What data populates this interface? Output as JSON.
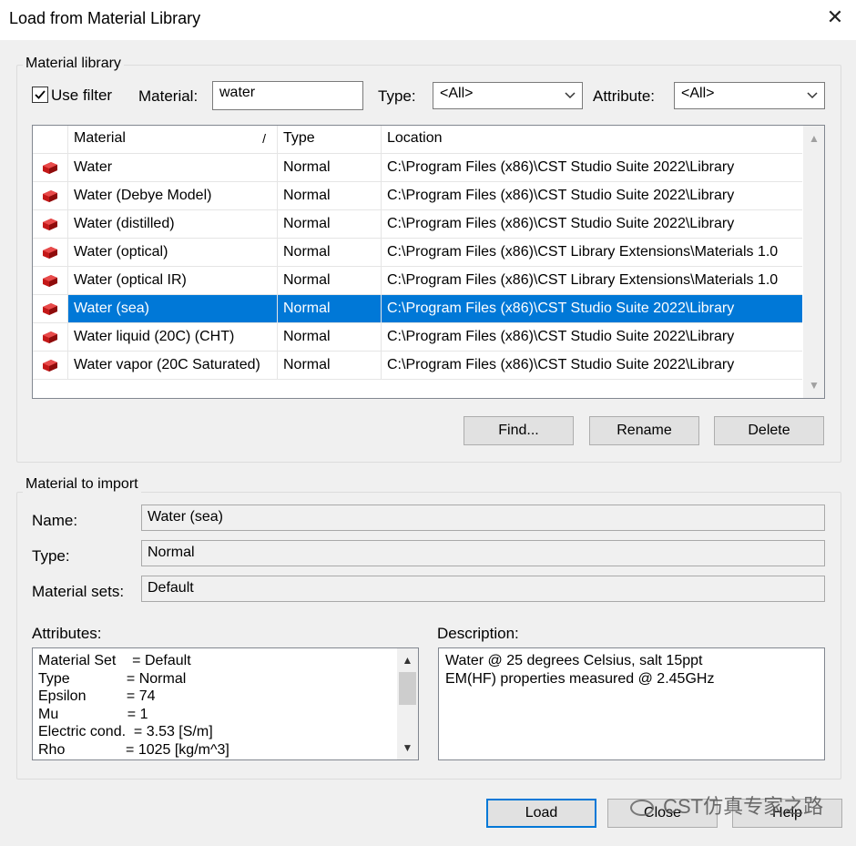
{
  "window": {
    "title": "Load from Material Library",
    "close_glyph": "✕"
  },
  "library": {
    "group_label": "Material library",
    "use_filter_label": "Use filter",
    "use_filter_checked": true,
    "material_label": "Material:",
    "material_value": "water",
    "type_label": "Type:",
    "type_value": "<All>",
    "attribute_label": "Attribute:",
    "attribute_value": "<All>",
    "columns": {
      "material": "Material",
      "sort_glyph": "/",
      "type": "Type",
      "location": "Location"
    },
    "rows": [
      {
        "name": "Water",
        "type": "Normal",
        "location": "C:\\Program Files (x86)\\CST Studio Suite 2022\\Library"
      },
      {
        "name": "Water (Debye Model)",
        "type": "Normal",
        "location": "C:\\Program Files (x86)\\CST Studio Suite 2022\\Library"
      },
      {
        "name": "Water (distilled)",
        "type": "Normal",
        "location": "C:\\Program Files (x86)\\CST Studio Suite 2022\\Library"
      },
      {
        "name": "Water (optical)",
        "type": "Normal",
        "location": "C:\\Program Files (x86)\\CST Library Extensions\\Materials 1.0"
      },
      {
        "name": "Water (optical IR)",
        "type": "Normal",
        "location": "C:\\Program Files (x86)\\CST Library Extensions\\Materials 1.0"
      },
      {
        "name": "Water (sea)",
        "type": "Normal",
        "location": "C:\\Program Files (x86)\\CST Studio Suite 2022\\Library"
      },
      {
        "name": "Water liquid (20C) (CHT)",
        "type": "Normal",
        "location": "C:\\Program Files (x86)\\CST Studio Suite 2022\\Library"
      },
      {
        "name": "Water vapor (20C Saturated)",
        "type": "Normal",
        "location": "C:\\Program Files (x86)\\CST Studio Suite 2022\\Library"
      }
    ],
    "selected_index": 5,
    "find_button": "Find...",
    "rename_button": "Rename",
    "delete_button": "Delete"
  },
  "import": {
    "group_label": "Material to import",
    "name_label": "Name:",
    "name_value": "Water (sea)",
    "type_label": "Type:",
    "type_value": "Normal",
    "sets_label": "Material sets:",
    "sets_value": "Default",
    "attributes_label": "Attributes:",
    "attributes_lines": [
      "Material Set    = Default",
      "Type              = Normal",
      "Epsilon          = 74",
      "Mu                 = 1",
      "Electric cond.  = 3.53 [S/m]",
      "Rho               = 1025 [kg/m^3]"
    ],
    "description_label": "Description:",
    "description_lines": [
      "Water @ 25 degrees Celsius, salt 15ppt",
      "EM(HF) properties measured @ 2.45GHz"
    ]
  },
  "footer": {
    "load_button": "Load",
    "close_button": "Close",
    "help_button": "Help"
  },
  "watermark": "CST仿真专家之路",
  "colors": {
    "selection": "#0078d7",
    "brick": "#d22020"
  }
}
